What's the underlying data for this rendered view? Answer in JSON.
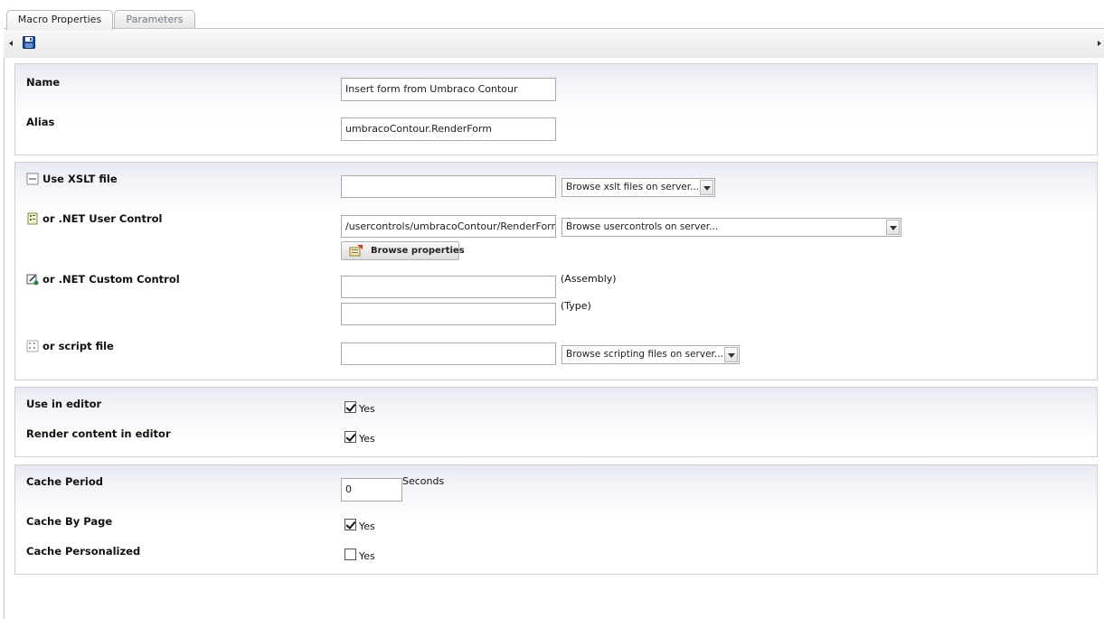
{
  "tabs": [
    {
      "label": "Macro Properties",
      "active": true
    },
    {
      "label": "Parameters",
      "active": false
    }
  ],
  "toolbar": {
    "save_icon": "save-icon"
  },
  "basic": {
    "name_label": "Name",
    "name_value": "Insert form from Umbraco Contour",
    "alias_label": "Alias",
    "alias_value": "umbracoContour.RenderForm"
  },
  "source": {
    "xslt_label": "Use XSLT file",
    "xslt_value": "",
    "xslt_select": "Browse xslt files on server...",
    "usercontrol_label": "or .NET User Control",
    "usercontrol_value": "/usercontrols/umbracoContour/RenderForm.ascx",
    "usercontrol_select": "Browse usercontrols on server...",
    "browse_properties": "Browse properties",
    "custom_label": "or .NET Custom Control",
    "assembly_value": "",
    "assembly_note": "(Assembly)",
    "type_value": "",
    "type_note": "(Type)",
    "script_label": "or script file",
    "script_value": "",
    "script_select": "Browse scripting files on server..."
  },
  "editor": {
    "use_label": "Use in editor",
    "use_checked": true,
    "render_label": "Render content in editor",
    "render_checked": true,
    "yes": "Yes"
  },
  "cache": {
    "period_label": "Cache Period",
    "period_value": "0",
    "period_unit": "Seconds",
    "by_page_label": "Cache By Page",
    "by_page_checked": true,
    "personalized_label": "Cache Personalized",
    "personalized_checked": false,
    "yes": "Yes"
  },
  "colors": {
    "panel_header": "#e8eaf3",
    "border": "#cfcfcf",
    "save_icon": "#1f4f9f"
  }
}
